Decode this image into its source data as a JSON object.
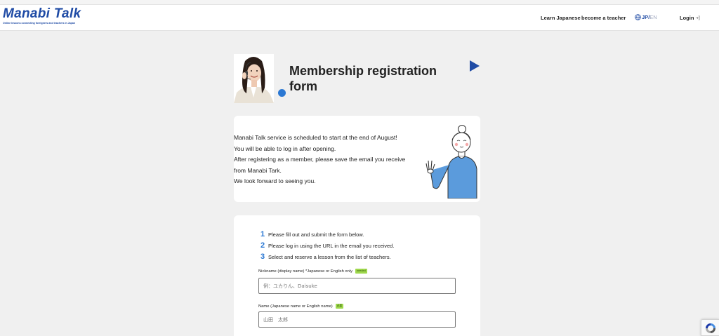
{
  "header": {
    "logo_text": "Manabi Talk",
    "logo_tagline": "Online lessons connecting foreigners and teachers in Japan",
    "nav": {
      "learn_japanese": "Learn Japanese",
      "become_teacher": "become a teacher"
    },
    "lang": {
      "jp": "JP",
      "sep": "/",
      "en": "EN"
    },
    "login": "Login"
  },
  "hero": {
    "title": "Membership registration form"
  },
  "notice": {
    "lines": [
      "Manabi Talk service is scheduled to start at the end of August!",
      "You will be able to log in after opening.",
      "After registering as a member, please save the email you receive",
      "from Manabi Tark.",
      "We look forward to seeing you."
    ]
  },
  "steps": [
    {
      "num": "1",
      "text": "Please fill out and submit the form below."
    },
    {
      "num": "2",
      "text": "Please log in using the URL in the email you received."
    },
    {
      "num": "3",
      "text": "Select and reserve a lesson from the list of teachers."
    }
  ],
  "form": {
    "nickname": {
      "label": "Nickname (display name) *Japanese or English only",
      "badge": "needed",
      "placeholder": "例：ユカりん、Daisuke"
    },
    "name": {
      "label": "Name (Japanese name or English name)",
      "badge": "必要",
      "placeholder": "山田　太郎"
    }
  },
  "colors": {
    "brand_blue": "#1f4ba5",
    "accent_blue": "#2b78d3",
    "required_green": "#9fd84d",
    "page_bg": "#f0f0f0"
  },
  "icons": {
    "lang": "globe-icon",
    "login": "login-arrow-icon",
    "captcha": "recaptcha-icon"
  }
}
